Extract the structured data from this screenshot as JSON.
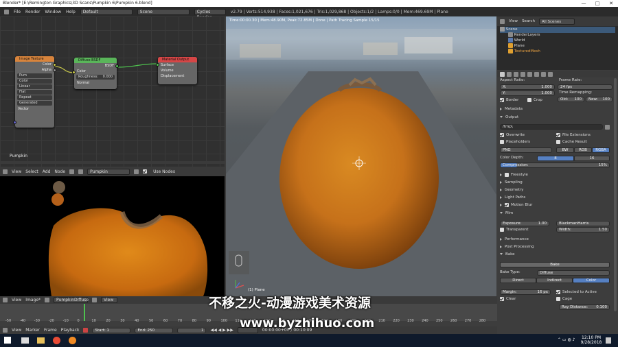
{
  "window": {
    "title": "Blender* [E:\\Remington Graphics\\3D Scans\\Pumpkin 6\\Pumpkin 6.blend]",
    "min": "—",
    "max": "□",
    "close": "✕"
  },
  "infobar": {
    "menus": [
      "File",
      "Render",
      "Window",
      "Help"
    ],
    "screen": "Default",
    "scene": "Scene",
    "engine": "Cycles Render",
    "stats": "v2.79 | Verts:514,938 | Faces:1,021,676 | Tris:1,029,868 | Objects:1/2 | Lamps:0/0 | Mem:469.69M | Plane"
  },
  "nodes": {
    "image_texture": {
      "title": "Image Texture",
      "outputs": [
        "Color",
        "Alpha"
      ],
      "image": "Pum",
      "opts": [
        "Color",
        "Linear",
        "Flat",
        "Repeat",
        "Generated"
      ],
      "input": "Vector"
    },
    "diffuse": {
      "title": "Diffuse BSDF",
      "out": "BSDF",
      "inputs": [
        "Color"
      ],
      "roughness_label": "Roughness:",
      "roughness": "0.000",
      "normal": "Normal"
    },
    "material_output": {
      "title": "Material Output",
      "inputs": [
        "Surface",
        "Volume",
        "Displacement"
      ]
    },
    "material_name": "Pumpkin"
  },
  "node_header": {
    "menus": [
      "View",
      "Select",
      "Add",
      "Node"
    ],
    "material": "Pumpkin",
    "use_nodes": "Use Nodes"
  },
  "uv_header": {
    "menus": [
      "View",
      "Image*"
    ],
    "image": "PumpkinDiffuse",
    "view": "View"
  },
  "viewport": {
    "stats": "Time:00:00.30 | Mem:48.90M, Peak:72.85M | Done | Path Tracing Sample 15/15",
    "object_label": "(1) Plane"
  },
  "outliner": {
    "view": "View",
    "search": "Search",
    "filter": "All Scenes",
    "items": [
      "Scene",
      "RenderLayers",
      "World",
      "Plane",
      "TexturedMesh"
    ]
  },
  "props": {
    "aspect_label": "Aspect Ratio:",
    "x_label": "X:",
    "x": "1.000",
    "y_label": "Y:",
    "y": "1.000",
    "frame_rate_label": "Frame Rate:",
    "frame_rate": "24 fps",
    "time_remap": "Time Remapping:",
    "old_label": "Old:",
    "old": "100",
    "new_label": "New:",
    "new": "100",
    "border": "Border",
    "crop": "Crop",
    "metadata": "Metadata",
    "output": "Output",
    "path": "/tmp\\",
    "overwrite": "Overwrite",
    "file_ext": "File Extensions",
    "placeholders": "Placeholders",
    "cache": "Cache Result",
    "format": "PNG",
    "bw": "BW",
    "rgb": "RGB",
    "rgba": "RGBA",
    "color_depth_label": "Color Depth:",
    "depth8": "8",
    "depth16": "16",
    "compression_label": "Compression:",
    "compression": "15%",
    "freestyle": "Freestyle",
    "sampling": "Sampling",
    "geometry": "Geometry",
    "light_paths": "Light Paths",
    "motion_blur": "Motion Blur",
    "film": "Film",
    "exposure_label": "Exposure:",
    "exposure": "1.00",
    "filter": "BlackmanHarris",
    "transparent": "Transparent",
    "width_label": "Width:",
    "width": "1.50",
    "performance": "Performance",
    "post_processing": "Post Processing",
    "bake": "Bake",
    "bake_button": "Bake",
    "bake_type_label": "Bake Type:",
    "bake_type": "Diffuse",
    "direct": "Direct",
    "indirect": "Indirect",
    "color": "Color",
    "margin_label": "Margin:",
    "margin": "16 px",
    "selected_to_active": "Selected to Active",
    "clear": "Clear",
    "cage": "Cage",
    "ray_distance_label": "Ray Distance:",
    "ray_distance": "0.100"
  },
  "timeline": {
    "ticks": [
      "-50",
      "-40",
      "-30",
      "-20",
      "-10",
      "0",
      "10",
      "20",
      "30",
      "40",
      "50",
      "60",
      "70",
      "80",
      "90",
      "100",
      "110",
      "120",
      "130",
      "140",
      "150",
      "160",
      "170",
      "180",
      "190",
      "200",
      "210",
      "220",
      "230",
      "240",
      "250",
      "260",
      "270",
      "280"
    ],
    "menus": [
      "View",
      "Marker",
      "Frame",
      "Playback"
    ],
    "start_label": "Start:",
    "start": "1",
    "end_label": "End:",
    "end": "250",
    "current": "1",
    "time": "00:00:00+00 / 00:10:09"
  },
  "taskbar": {
    "time": "12:10 PM",
    "date": "9/28/2018"
  },
  "watermark": {
    "line1": "不移之火-动漫游戏美术资源",
    "line2": "www.byzhihuo.com"
  }
}
